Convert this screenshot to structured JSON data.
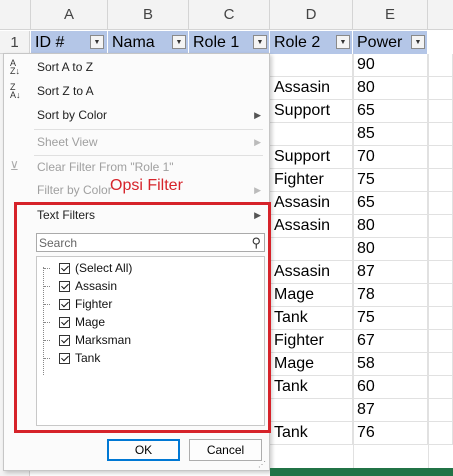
{
  "columns": [
    "A",
    "B",
    "C",
    "D",
    "E"
  ],
  "row_numbers": [
    "1"
  ],
  "header_row": [
    "ID #",
    "Nama",
    "Role 1",
    "Role 2",
    "Power"
  ],
  "visible_rows": [
    {
      "role2": "",
      "power": "90"
    },
    {
      "role2": "Assasin",
      "power": "80"
    },
    {
      "role2": "Support",
      "power": "65"
    },
    {
      "role2": "",
      "power": "85"
    },
    {
      "role2": "Support",
      "power": "70"
    },
    {
      "role2": "Fighter",
      "power": "75"
    },
    {
      "role2": "Assasin",
      "power": "65"
    },
    {
      "role2": "Assasin",
      "power": "80"
    },
    {
      "role2": "",
      "power": "80"
    },
    {
      "role2": "Assasin",
      "power": "87"
    },
    {
      "role2": "Mage",
      "power": "78"
    },
    {
      "role2": "Tank",
      "power": "75"
    },
    {
      "role2": "Fighter",
      "power": "67"
    },
    {
      "role2": "Mage",
      "power": "58"
    },
    {
      "role2": "Tank",
      "power": "60"
    },
    {
      "role2": "",
      "power": "87"
    },
    {
      "role2": "Tank",
      "power": "76"
    }
  ],
  "filter_menu": {
    "sort_asc": "Sort A to Z",
    "sort_desc": "Sort Z to A",
    "sort_color": "Sort by Color",
    "sheet_view": "Sheet View",
    "clear_filter": "Clear Filter From \"Role 1\"",
    "filter_color": "Filter by Color",
    "text_filters": "Text Filters",
    "search_placeholder": "Search",
    "items": [
      "(Select All)",
      "Assasin",
      "Fighter",
      "Mage",
      "Marksman",
      "Tank"
    ],
    "ok": "OK",
    "cancel": "Cancel"
  },
  "annotation": "Opsi Filter",
  "colors": {
    "header_fill": "#b4c6e7",
    "highlight": "#d6232a",
    "excel_green": "#217346"
  }
}
